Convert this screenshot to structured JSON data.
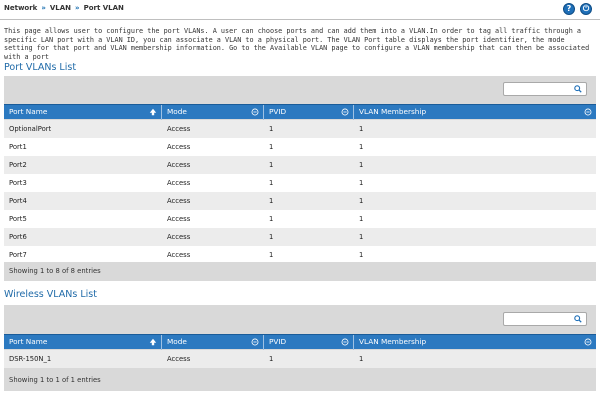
{
  "breadcrumb": {
    "items": [
      "Network",
      "VLAN",
      "Port VLAN"
    ],
    "separator": "»"
  },
  "header_buttons": {
    "help_label": "?",
    "logout_label": "⏻"
  },
  "description": "This page allows user to configure the port VLANs. A user can choose ports and can add them into a VLAN.In order to tag all traffic through a specific LAN port with a VLAN ID, you can associate a VLAN to a physical port. The VLAN Port table displays the port identifier, the mode setting for that port and VLAN membership information. Go to the Available VLAN page to configure a VLAN membership that can then be associated with a port",
  "port_table": {
    "title": "Port VLANs List",
    "columns": [
      "Port Name",
      "Mode",
      "PVID",
      "VLAN Membership"
    ],
    "rows": [
      [
        "OptionalPort",
        "Access",
        "1",
        "1"
      ],
      [
        "Port1",
        "Access",
        "1",
        "1"
      ],
      [
        "Port2",
        "Access",
        "1",
        "1"
      ],
      [
        "Port3",
        "Access",
        "1",
        "1"
      ],
      [
        "Port4",
        "Access",
        "1",
        "1"
      ],
      [
        "Port5",
        "Access",
        "1",
        "1"
      ],
      [
        "Port6",
        "Access",
        "1",
        "1"
      ],
      [
        "Port7",
        "Access",
        "1",
        "1"
      ]
    ],
    "footer": "Showing 1 to 8 of 8 entries"
  },
  "wireless_table": {
    "title": "Wireless VLANs List",
    "columns": [
      "Port Name",
      "Mode",
      "PVID",
      "VLAN Membership"
    ],
    "rows": [
      [
        "DSR-150N_1",
        "Access",
        "1",
        "1"
      ]
    ],
    "footer": "Showing 1 to 1 of 1 entries"
  },
  "colors": {
    "header_blue": "#2c79c0",
    "title_blue": "#1f6aa8",
    "panel_gray": "#d9d9d9"
  }
}
